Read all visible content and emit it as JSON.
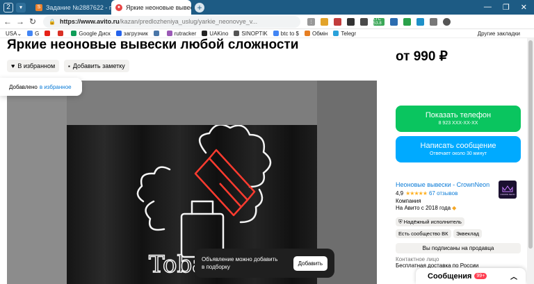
{
  "browser": {
    "tab_count": "2",
    "tabs": [
      {
        "label": "Задание №2887622 - про"
      },
      {
        "label": "Яркие неоновые вывес"
      }
    ],
    "url_host": "https://www.avito.ru",
    "url_path": "/kazan/predlozheniya_uslug/yarkie_neonovye_v...",
    "bookmarks": [
      "USA",
      "G",
      "Google Диск",
      "загрузчик",
      "rutracker",
      "UAKino",
      "SINOPTIK",
      "btc to $",
      "Обмін",
      "Telegr"
    ],
    "other_bookmarks": "Другие закладки",
    "extension_badge": "LTC 53.8"
  },
  "listing": {
    "title": "Яркие неоновые вывески любой сложности",
    "favorite_label": "В избранном",
    "note_label": "Добавить заметку",
    "tooltip_text": "Добавлено",
    "tooltip_link": "в избранное",
    "photo_text": "Tobacco"
  },
  "toast": {
    "text_line1": "Объявление можно добавить",
    "text_line2": "в подборку",
    "button": "Добавить"
  },
  "sidebar": {
    "price": "от 990 ₽",
    "show_phone": "Показать телефон",
    "phone_masked": "8 923 XXX-XX-XX",
    "write_message": "Написать сообщение",
    "reply_time": "Отвечает около 30 минут",
    "seller_name": "Неоновые вывески - CrownNeon",
    "rating": "4,9",
    "reviews": "67 отзывов",
    "seller_type": "Компания",
    "since": "На Авито с 2018 года",
    "badges": [
      "Надёжный исполнитель",
      "Есть сообщество ВК",
      "Эквеклад"
    ],
    "subscribed": "Вы подписаны на продавца",
    "contact_person": "Контактное лицо",
    "delivery": "Бесплатная доставка по России",
    "logo_text": "CROWN NEON"
  },
  "messages": {
    "label": "Сообщения",
    "count": "99+"
  }
}
